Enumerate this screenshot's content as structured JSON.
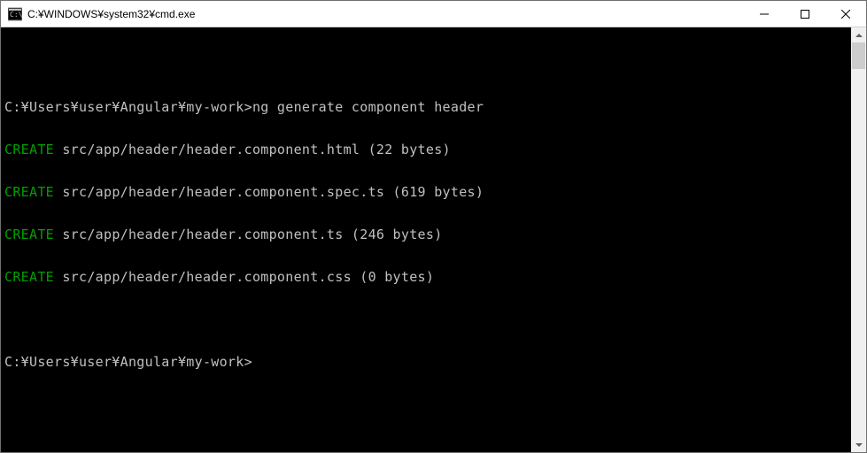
{
  "titlebar": {
    "title": "C:¥WINDOWS¥system32¥cmd.exe"
  },
  "terminal": {
    "line1_prompt": "C:¥Users¥user¥Angular¥my-work>",
    "line1_cmd": "ng generate component header",
    "create_label": "CREATE",
    "line2_path": " src/app/header/header.component.html (22 bytes)",
    "line3_path": " src/app/header/header.component.spec.ts (619 bytes)",
    "line4_path": " src/app/header/header.component.ts (246 bytes)",
    "line5_path": " src/app/header/header.component.css (0 bytes)",
    "line6_prompt": "C:¥Users¥user¥Angular¥my-work>"
  }
}
